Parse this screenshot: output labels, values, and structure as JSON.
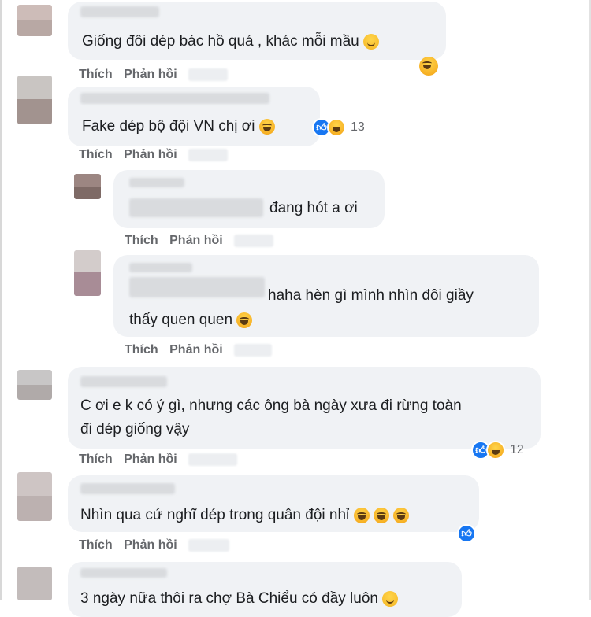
{
  "actions": {
    "like": "Thích",
    "reply": "Phản hồi"
  },
  "comments": [
    {
      "text": "Giống đôi dép bác hồ quá , khác mỗi mầu",
      "reactions": ""
    },
    {
      "text": "Fake dép bộ đội VN chị ơi",
      "reactions": "13"
    },
    {
      "text": "đang hót a ơi",
      "reactions": ""
    },
    {
      "line1": "haha hèn gì mình nhìn đôi giầy",
      "line2": "thấy quen quen",
      "reactions": ""
    },
    {
      "line1": "C ơi e k có ý gì, nhưng các ông bà ngày xưa đi rừng toàn",
      "line2": "đi dép giống vậy",
      "reactions": "12"
    },
    {
      "text": "Nhìn qua cứ nghĩ dép trong quân đội nhỉ",
      "reactions": ""
    },
    {
      "text": "3 ngày nữa thôi ra chợ Bà Chiểu có đầy luôn",
      "reactions": ""
    }
  ],
  "icons": {
    "like": "like-reaction-icon",
    "haha": "haha-reaction-icon",
    "smile": "smile-emoji-icon"
  },
  "colors": {
    "bubble": "#f0f2f5",
    "action": "#65676b",
    "like_blue": "#1877f2"
  }
}
